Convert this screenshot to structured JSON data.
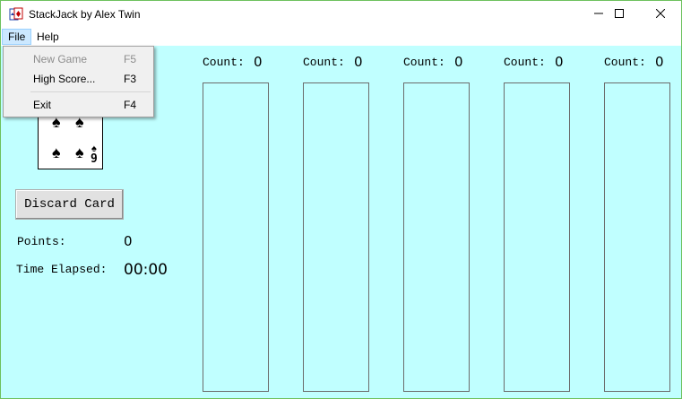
{
  "window": {
    "title": "StackJack by Alex Twin"
  },
  "icons": {
    "app": "cards-icon",
    "minimize": "minimize-icon",
    "maximize": "maximize-icon",
    "close": "close-icon",
    "card_suit": "spade-icon"
  },
  "menubar": {
    "items": [
      {
        "label": "File"
      },
      {
        "label": "Help"
      }
    ]
  },
  "file_menu": {
    "items": [
      {
        "label": "New Game",
        "shortcut": "F5",
        "enabled": false
      },
      {
        "label": "High Score...",
        "shortcut": "F3",
        "enabled": true
      },
      {
        "label": "Exit",
        "shortcut": "F4",
        "enabled": true
      }
    ]
  },
  "card": {
    "rank": "9",
    "suit": "spades"
  },
  "discard_button": {
    "label": "Discard Card"
  },
  "stats": {
    "points_label": "Points:",
    "points_value": "0",
    "time_label": "Time Elapsed:",
    "time_value": "00:00"
  },
  "stacks": [
    {
      "count_label": "Count:",
      "count_value": "0"
    },
    {
      "count_label": "Count:",
      "count_value": "0"
    },
    {
      "count_label": "Count:",
      "count_value": "0"
    },
    {
      "count_label": "Count:",
      "count_value": "0"
    },
    {
      "count_label": "Count:",
      "count_value": "0"
    }
  ],
  "colors": {
    "board_background": "#c0ffff",
    "window_border": "#6ec15e",
    "menu_highlight": "#cce8ff"
  }
}
